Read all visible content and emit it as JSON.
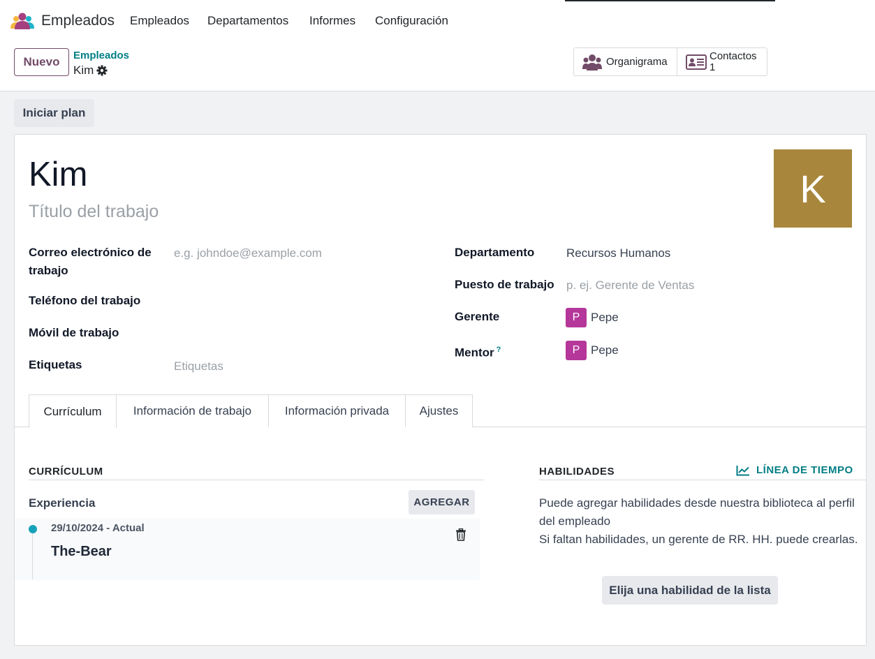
{
  "navbar": {
    "app_name": "Empleados",
    "menu": [
      "Empleados",
      "Departamentos",
      "Informes",
      "Configuración"
    ]
  },
  "control_panel": {
    "new_button": "Nuevo",
    "breadcrumb_parent": "Empleados",
    "breadcrumb_current": "Kim",
    "smart_buttons": {
      "org_chart": "Organigrama",
      "contacts_label": "Contactos",
      "contacts_count": "1"
    }
  },
  "actions": {
    "start_plan": "Iniciar plan"
  },
  "employee": {
    "name": "Kim",
    "job_title_placeholder": "Título del trabajo",
    "avatar_letter": "K",
    "avatar_color": "#a8873d"
  },
  "fields_left": {
    "work_email_label": "Correo electrónico de trabajo",
    "work_email_placeholder": "e.g. johndoe@example.com",
    "work_phone_label": "Teléfono del trabajo",
    "mobile_label": "Móvil de trabajo",
    "tags_label": "Etiquetas",
    "tags_placeholder": "Etiquetas"
  },
  "fields_right": {
    "department_label": "Departamento",
    "department_value": "Recursos Humanos",
    "job_position_label": "Puesto de trabajo",
    "job_position_placeholder": "p. ej. Gerente de Ventas",
    "manager_label": "Gerente",
    "manager_initial": "P",
    "manager_name": "Pepe",
    "coach_label": "Mentor",
    "coach_help": "?",
    "coach_initial": "P",
    "coach_name": "Pepe",
    "user_avatar_color": "#b5379a"
  },
  "tabs": [
    "Currículum",
    "Información de trabajo",
    "Información privada",
    "Ajustes"
  ],
  "resume": {
    "section_title": "CURRÍCULUM",
    "experience_label": "Experiencia",
    "add_button": "AGREGAR",
    "lines": [
      {
        "date": "29/10/2024 - Actual",
        "name": "The-Bear"
      }
    ]
  },
  "skills": {
    "section_title": "HABILIDADES",
    "timeline_link": "LÍNEA DE TIEMPO",
    "help_line1": "Puede agregar habilidades desde nuestra biblioteca al perfil del empleado",
    "help_line2": "Si faltan habilidades, un gerente de RR. HH. puede crearlas.",
    "pick_button": "Elija una habilidad de la lista"
  },
  "colors": {
    "brand": "#714b67",
    "link": "#017e84",
    "timeline_dot": "#17a2b8"
  }
}
